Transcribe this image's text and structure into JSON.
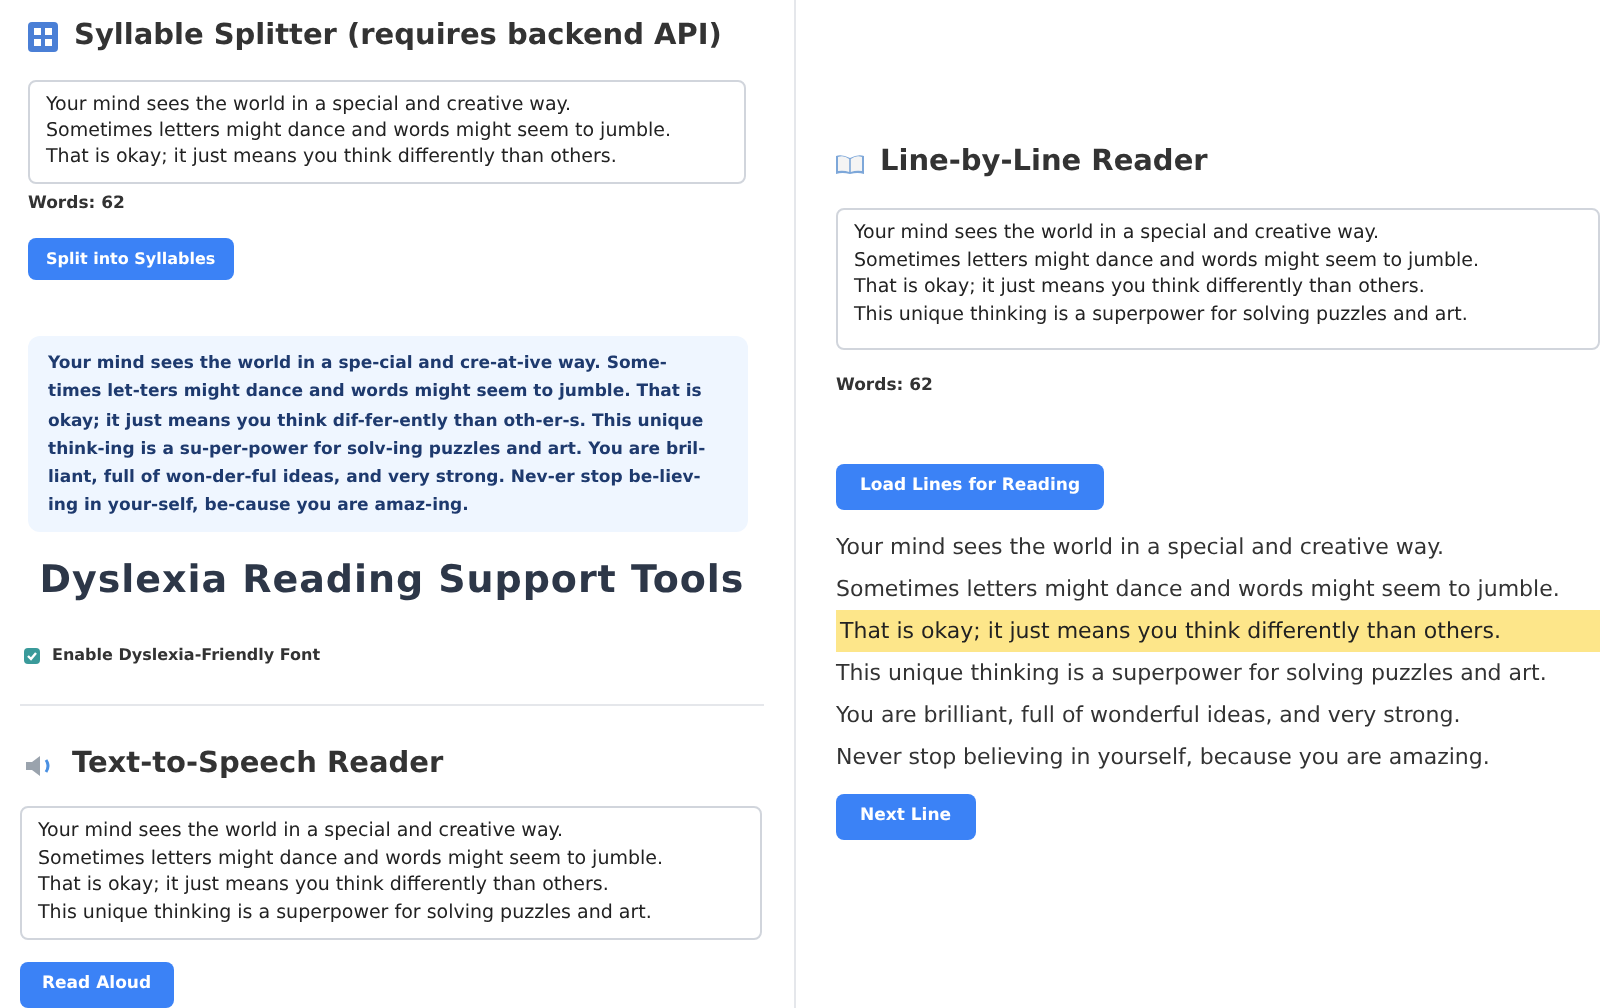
{
  "syllable_splitter": {
    "title": "Syllable Splitter (requires backend API)",
    "input": "Your mind sees the world in a special and creative way.\nSometimes letters might dance and words might seem to jumble.\nThat is okay; it just means you think differently than others.",
    "word_count": "Words: 62",
    "button": "Split into Syllables",
    "output": "Your mind sees the world in a spe-cial and cre-at-ive way. Some-\ntimes let-ters might dance and words might seem to jumble. That is\nokay; it just means you think dif-fer-ently than oth-er-s. This unique\nthink-ing is a su-per-power for solv-ing puzzles and art. You are bril-\nliant, full of won-der-ful ideas, and very strong. Nev-er stop be-liev-\ning in your-self, be-cause you are amaz-ing."
  },
  "page_title": "Dyslexia Reading Support Tools",
  "font_toggle": {
    "label": "Enable Dyslexia-Friendly Font",
    "checked": true
  },
  "text_to_speech": {
    "title": "Text-to-Speech Reader",
    "input": "Your mind sees the world in a special and creative way.\nSometimes letters might dance and words might seem to jumble.\nThat is okay; it just means you think differently than others.\nThis unique thinking is a superpower for solving puzzles and art.",
    "button": "Read Aloud"
  },
  "line_reader": {
    "title": "Line-by-Line Reader",
    "input": "Your mind sees the world in a special and creative way.\nSometimes letters might dance and words might seem to jumble.\nThat is okay; it just means you think differently than others.\nThis unique thinking is a superpower for solving puzzles and art.",
    "word_count": "Words: 62",
    "load_button": "Load Lines for Reading",
    "lines": [
      {
        "text": "Your mind sees the world in a special and creative way.",
        "selected": false
      },
      {
        "text": "Sometimes letters might dance and words might seem to jumble.",
        "selected": false
      },
      {
        "text": "That is okay; it just means you think differently than others.",
        "selected": true
      },
      {
        "text": "This unique thinking is a superpower for solving puzzles and art.",
        "selected": false
      },
      {
        "text": "You are brilliant, full of wonderful ideas, and very strong.",
        "selected": false
      },
      {
        "text": "Never stop believing in yourself, because you are amazing.",
        "selected": false
      }
    ],
    "next_button": "Next Line"
  }
}
